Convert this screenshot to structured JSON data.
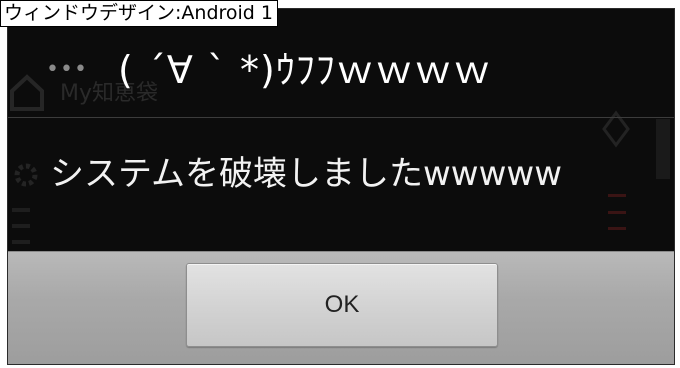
{
  "caption": "ウィンドウデザイン:Android 1",
  "background_app": {
    "item_label": "My知恵袋"
  },
  "dialog": {
    "menu_icon": "overflow-dots-icon",
    "menu_glyph": "•••",
    "title": "( ´∀ ` *)ｳﾌﾌｗｗｗｗ",
    "message": "システムを破壊しましたwwwww",
    "ok_label": "OK"
  },
  "colors": {
    "dialog_background": "#050505",
    "title_text": "#ffffff",
    "button_bar": "#a9a9a9",
    "button_face": "#d2d2d2"
  }
}
